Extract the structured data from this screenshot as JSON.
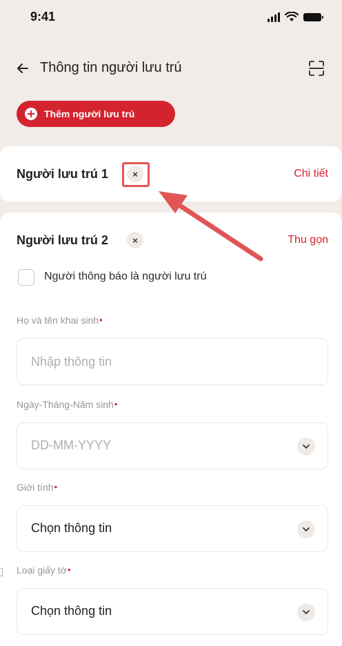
{
  "status_bar": {
    "time": "9:41"
  },
  "header": {
    "title": "Thông tin người lưu trú"
  },
  "add_button": {
    "label": "Thêm người lưu trú"
  },
  "residents": [
    {
      "title": "Người lưu trú 1",
      "remove_symbol": "×",
      "link": "Chi tiết",
      "state": "collapsed"
    },
    {
      "title": "Người lưu trú 2",
      "remove_symbol": "×",
      "link": "Thu gọn",
      "state": "expanded"
    }
  ],
  "form": {
    "notifier_checkbox_label": "Người thông báo là người lưu trú",
    "notifier_checked": false,
    "required_mark": "•",
    "full_name": {
      "label": "Họ và tên khai sinh",
      "placeholder": "Nhập thông tin",
      "value": ""
    },
    "birth_date": {
      "label": "Ngày-Tháng-Năm sinh",
      "placeholder": "DD-MM-YYYY"
    },
    "gender": {
      "label": "Giới tính",
      "value": "Chọn thông tin"
    },
    "document_type": {
      "label": "Loại giấy tờ",
      "value": "Chọn thông tin"
    }
  },
  "colors": {
    "accent": "#d3232f",
    "background": "#f1ece8",
    "annotation": "#e05555"
  },
  "icons": [
    "back-arrow-icon",
    "scan-icon",
    "plus-circle-icon",
    "close-icon",
    "chevron-down-icon",
    "signal-icon",
    "wifi-icon",
    "battery-icon"
  ]
}
